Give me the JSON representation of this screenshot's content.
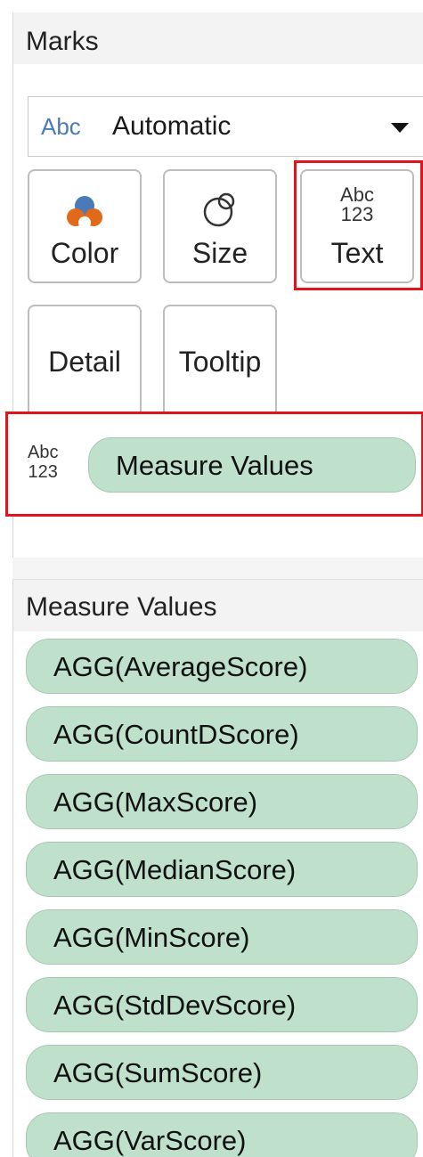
{
  "marks": {
    "title": "Marks",
    "mark_type": {
      "icon_text": "Abc",
      "label": "Automatic"
    },
    "buttons": {
      "color": "Color",
      "size": "Size",
      "text": "Text",
      "text_icon_top": "Abc",
      "text_icon_bottom": "123",
      "detail": "Detail",
      "tooltip": "Tooltip"
    },
    "text_shelf": {
      "icon_top": "Abc",
      "icon_bottom": "123",
      "pill": "Measure Values"
    }
  },
  "measure_values": {
    "title": "Measure Values",
    "items": [
      "AGG(AverageScore)",
      "AGG(CountDScore)",
      "AGG(MaxScore)",
      "AGG(MedianScore)",
      "AGG(MinScore)",
      "AGG(StdDevScore)",
      "AGG(SumScore)",
      "AGG(VarScore)"
    ]
  },
  "colors": {
    "pill_fill": "#bfe1cc",
    "highlight": "#e0141e",
    "abc_blue": "#4a7ab8",
    "color_icon_orange": "#e06a1a",
    "color_icon_blue": "#4a7ab8"
  },
  "icons": [
    "color-icon",
    "size-icon",
    "text-icon",
    "dropdown-arrow-icon",
    "abc-123-icon"
  ]
}
